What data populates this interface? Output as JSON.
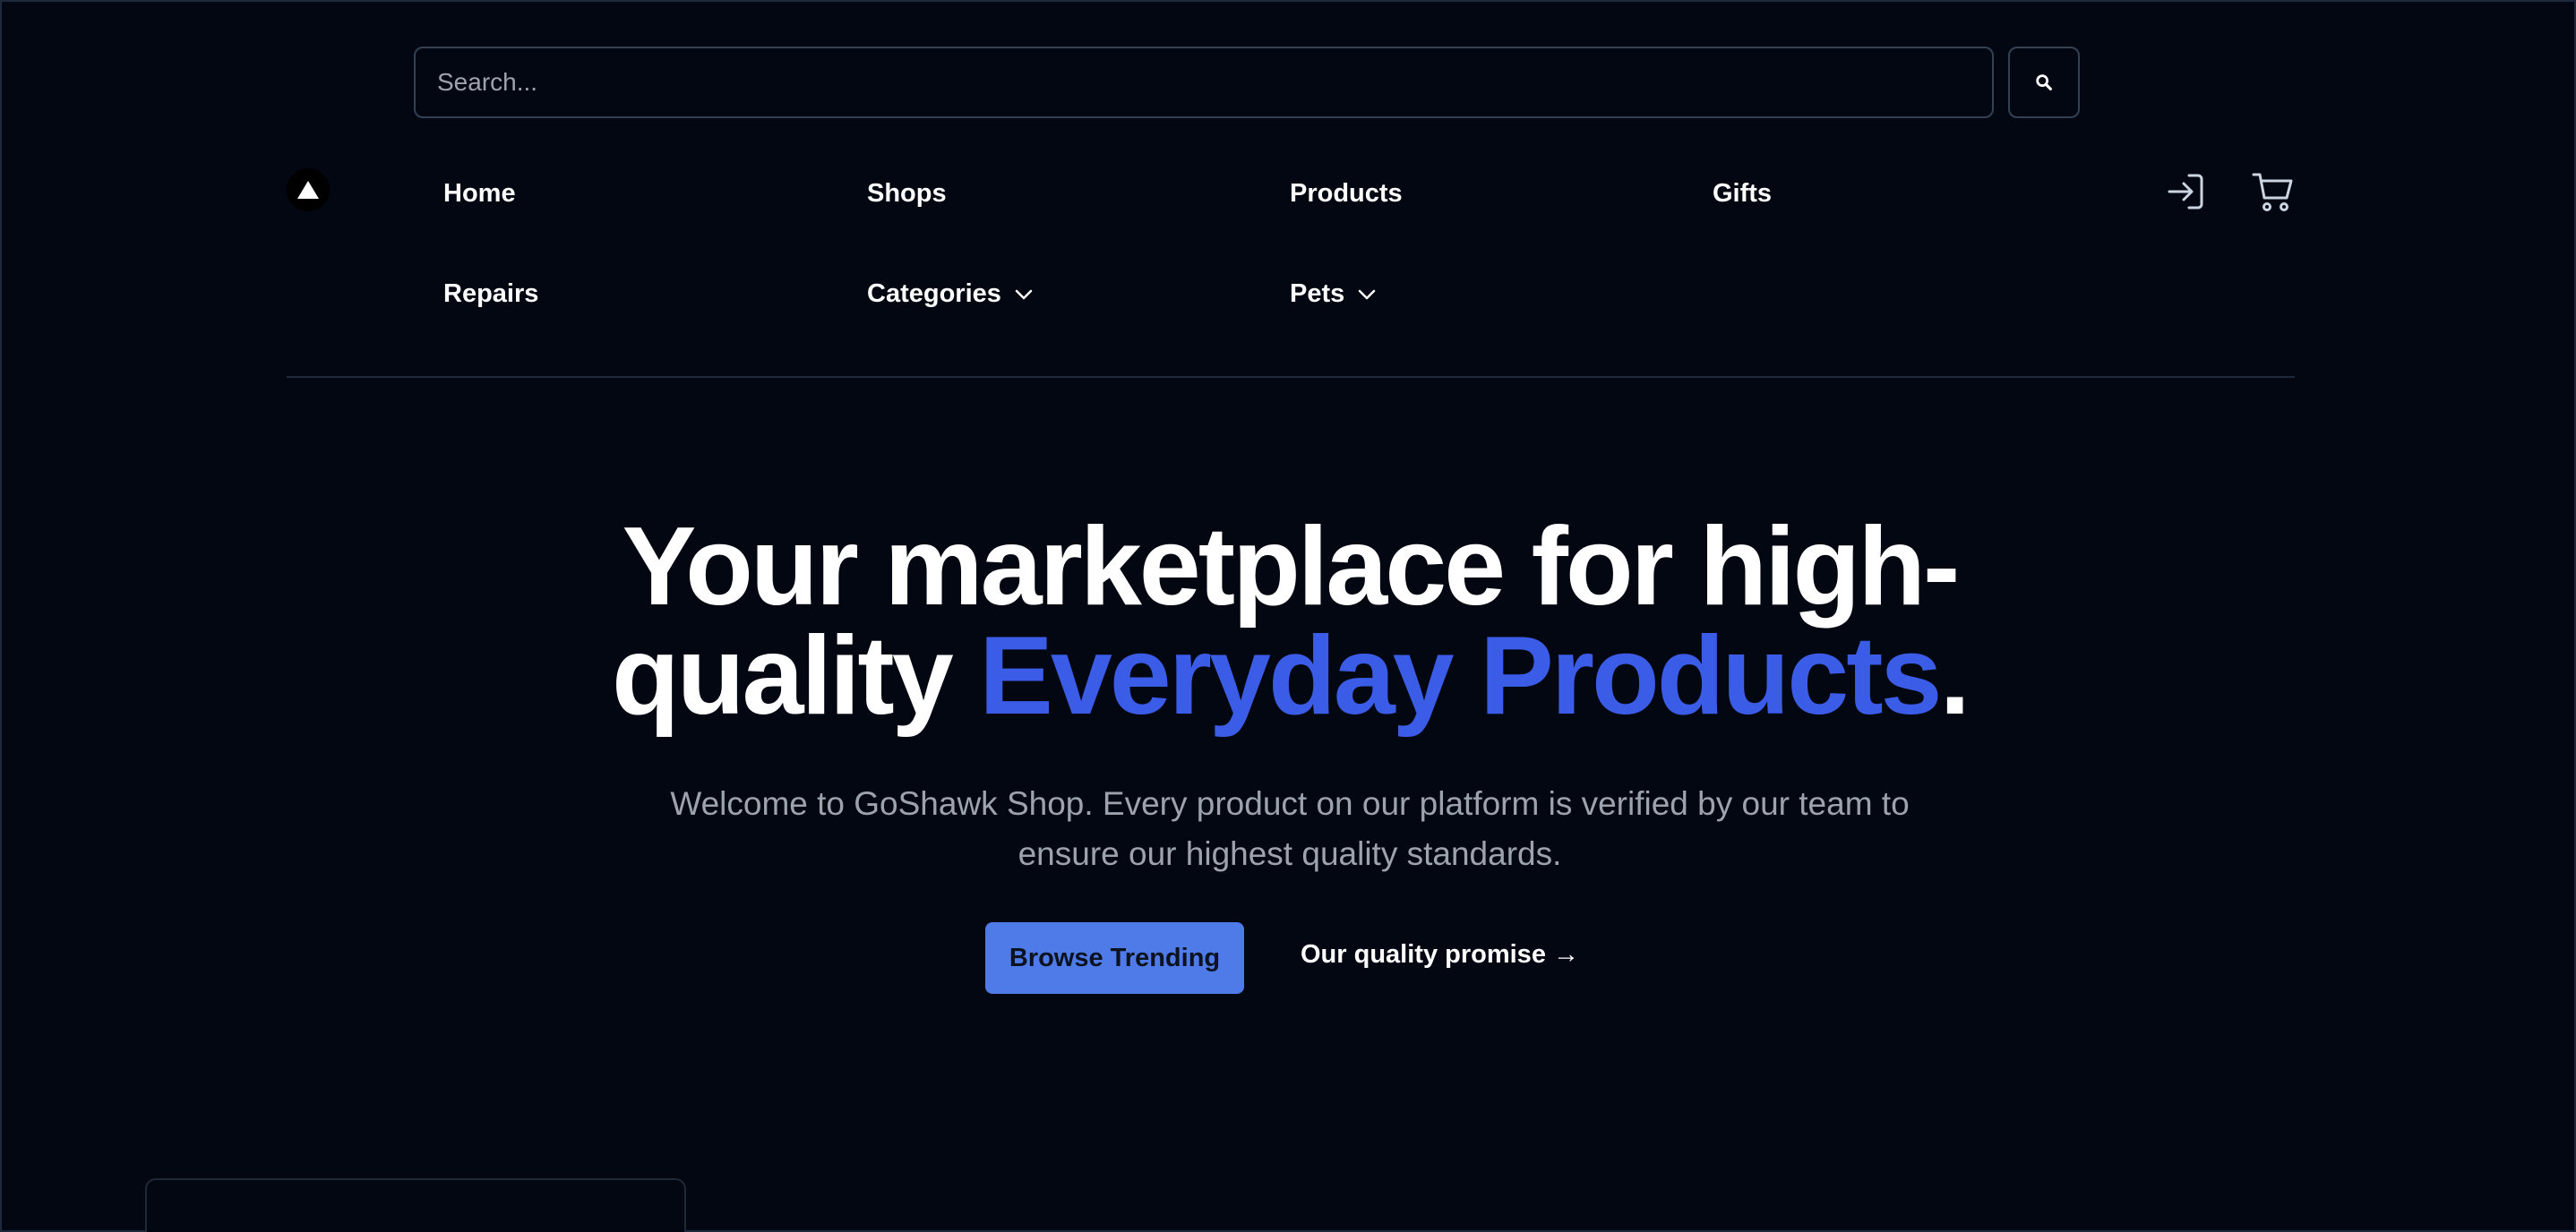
{
  "search": {
    "placeholder": "Search..."
  },
  "icons": {
    "logo": "triangle-logo-icon",
    "search": "search-icon",
    "login": "login-icon",
    "cart": "cart-icon",
    "chevron": "chevron-down-icon"
  },
  "nav": {
    "items": [
      {
        "label": "Home"
      },
      {
        "label": "Shops"
      },
      {
        "label": "Products"
      },
      {
        "label": "Gifts"
      },
      {
        "label": "Repairs"
      },
      {
        "label": "Categories"
      },
      {
        "label": "Pets"
      }
    ]
  },
  "hero": {
    "title_part1": "Your marketplace for high-",
    "title_part2": "quality ",
    "title_accent": "Everyday Products",
    "title_end": ".",
    "subtitle": "Welcome to GoShawk Shop. Every product on our platform is verified by our team to ensure our highest quality standards.",
    "primary_cta": "Browse Trending",
    "secondary_cta": "Our quality promise →"
  },
  "colors": {
    "background": "#030712",
    "accent": "#3b5ce6",
    "button": "#4f7be8",
    "muted_text": "#9ca3af"
  }
}
